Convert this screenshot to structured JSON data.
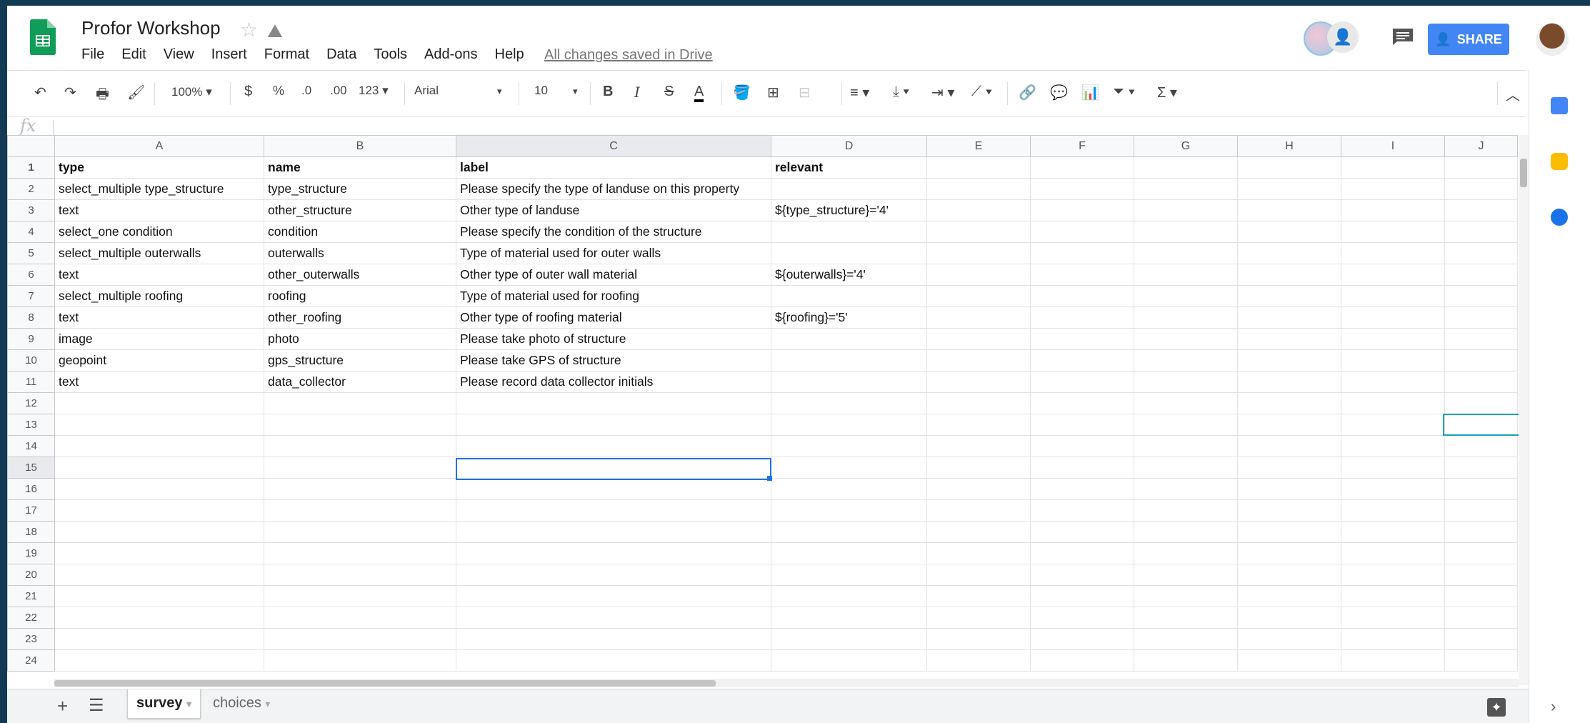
{
  "doc": {
    "title": "Profor Workshop",
    "saved_status": "All changes saved in Drive"
  },
  "menu": [
    "File",
    "Edit",
    "View",
    "Insert",
    "Format",
    "Data",
    "Tools",
    "Add-ons",
    "Help"
  ],
  "header_right": {
    "share_label": "SHARE"
  },
  "toolbar": {
    "zoom": "100%",
    "currency": "$",
    "percent": "%",
    "dec_decrease": ".0",
    "dec_increase": ".00",
    "format_more": "123",
    "font": "Arial",
    "font_size": "10",
    "bold": "B",
    "italic": "I",
    "strike": "S",
    "text_color": "A"
  },
  "formula": {
    "fx": "fx",
    "value": ""
  },
  "columns": [
    "A",
    "B",
    "C",
    "D",
    "E",
    "F",
    "G",
    "H",
    "I",
    "J"
  ],
  "rows": [
    [
      "type",
      "name",
      "label",
      "relevant",
      "",
      "",
      "",
      "",
      "",
      ""
    ],
    [
      "select_multiple type_structure",
      "type_structure",
      "Please specify the type of landuse on this property",
      "",
      "",
      "",
      "",
      "",
      "",
      ""
    ],
    [
      "text",
      "other_structure",
      "Other type of landuse",
      "${type_structure}='4'",
      "",
      "",
      "",
      "",
      "",
      ""
    ],
    [
      "select_one condition",
      "condition",
      "Please specify the condition of the structure",
      "",
      "",
      "",
      "",
      "",
      "",
      ""
    ],
    [
      "select_multiple outerwalls",
      "outerwalls",
      "Type of material used for outer walls",
      "",
      "",
      "",
      "",
      "",
      "",
      ""
    ],
    [
      "text",
      "other_outerwalls",
      "Other type of outer wall material",
      "${outerwalls}='4'",
      "",
      "",
      "",
      "",
      "",
      ""
    ],
    [
      "select_multiple roofing",
      "roofing",
      "Type of material used for roofing",
      "",
      "",
      "",
      "",
      "",
      "",
      ""
    ],
    [
      "text",
      "other_roofing",
      "Other type of roofing material",
      "${roofing}='5'",
      "",
      "",
      "",
      "",
      "",
      ""
    ],
    [
      "image",
      "photo",
      "Please take photo of structure",
      "",
      "",
      "",
      "",
      "",
      "",
      ""
    ],
    [
      "geopoint",
      "gps_structure",
      "Please take GPS of structure",
      "",
      "",
      "",
      "",
      "",
      "",
      ""
    ],
    [
      "text",
      "data_collector",
      "Please record data collector initials",
      "",
      "",
      "",
      "",
      "",
      "",
      ""
    ],
    [
      "",
      "",
      "",
      "",
      "",
      "",
      "",
      "",
      "",
      ""
    ],
    [
      "",
      "",
      "",
      "",
      "",
      "",
      "",
      "",
      "",
      ""
    ],
    [
      "",
      "",
      "",
      "",
      "",
      "",
      "",
      "",
      "",
      ""
    ],
    [
      "",
      "",
      "",
      "",
      "",
      "",
      "",
      "",
      "",
      ""
    ],
    [
      "",
      "",
      "",
      "",
      "",
      "",
      "",
      "",
      "",
      ""
    ],
    [
      "",
      "",
      "",
      "",
      "",
      "",
      "",
      "",
      "",
      ""
    ],
    [
      "",
      "",
      "",
      "",
      "",
      "",
      "",
      "",
      "",
      ""
    ],
    [
      "",
      "",
      "",
      "",
      "",
      "",
      "",
      "",
      "",
      ""
    ],
    [
      "",
      "",
      "",
      "",
      "",
      "",
      "",
      "",
      "",
      ""
    ],
    [
      "",
      "",
      "",
      "",
      "",
      "",
      "",
      "",
      "",
      ""
    ],
    [
      "",
      "",
      "",
      "",
      "",
      "",
      "",
      "",
      "",
      ""
    ],
    [
      "",
      "",
      "",
      "",
      "",
      "",
      "",
      "",
      "",
      ""
    ],
    [
      "",
      "",
      "",
      "",
      "",
      "",
      "",
      "",
      "",
      ""
    ]
  ],
  "row_numbers": [
    "1",
    "2",
    "3",
    "4",
    "5",
    "6",
    "7",
    "8",
    "9",
    "10",
    "11",
    "12",
    "13",
    "14",
    "15",
    "16",
    "17",
    "18",
    "19",
    "20",
    "21",
    "22",
    "23",
    "24"
  ],
  "sheets": {
    "active": "survey",
    "other": "choices"
  },
  "colors": {
    "accent": "#1a73e8",
    "share": "#4285f4",
    "sheets_green": "#0f9d58",
    "collaborator": "#12a4b8"
  }
}
